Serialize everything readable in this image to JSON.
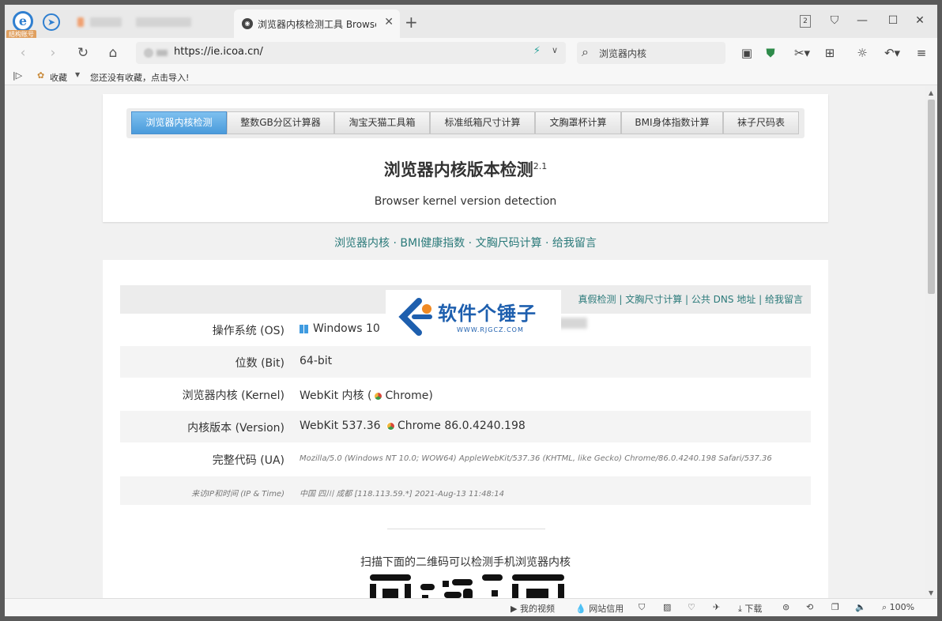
{
  "tab": {
    "active_title": "浏览器内核检测工具 Browser I",
    "close_glyph": "✕",
    "new_tab_glyph": "+",
    "tab_count": "2"
  },
  "logo": {
    "letter": "e",
    "badge": "结构账号"
  },
  "window_controls": {
    "skin": "⛉",
    "minimize": "—",
    "maximize": "☐",
    "close": "✕"
  },
  "toolbar": {
    "back": "‹",
    "forward": "›",
    "reload": "↻",
    "home": "⌂",
    "url": "https://ie.icoa.cn/",
    "bolt": "⚡",
    "url_dropdown": "∨",
    "search_text": "浏览器内核"
  },
  "bookmarks": {
    "toggle": "|▷",
    "label": "收藏",
    "empty_text": "您还没有收藏，点击导入!"
  },
  "page": {
    "nav_tabs": [
      "浏览器内核检测",
      "整数GB分区计算器",
      "淘宝天猫工具箱",
      "标准纸箱尺寸计算",
      "文胸罩杯计算",
      "BMI身体指数计算",
      "袜子尺码表"
    ],
    "title": "浏览器内核版本检测",
    "version": "2.1",
    "subtitle": "Browser kernel version detection",
    "links": "浏览器内核 · BMI健康指数 · 文胸尺码计算 · 给我留言",
    "card_links": "真假检测 | 文胸尺寸计算 | 公共 DNS 地址 | 给我留言",
    "rows": [
      {
        "label": "操作系统 (OS)",
        "value": "Windows 10"
      },
      {
        "label": "位数 (Bit)",
        "value": "64-bit"
      },
      {
        "label": "浏览器内核 (Kernel)",
        "value_pre": "WebKit 内核 (",
        "value_post": "Chrome)"
      },
      {
        "label": "内核版本 (Version)",
        "value_pre": "WebKit 537.36 ",
        "value_post": "Chrome 86.0.4240.198"
      },
      {
        "label": "完整代码 (UA)",
        "value": "Mozilla/5.0 (Windows NT 10.0; WOW64) AppleWebKit/537.36 (KHTML, like Gecko) Chrome/86.0.4240.198 Safari/537.36"
      },
      {
        "label": "来访IP和时间 (IP & Time)",
        "value": "中国 四川 成都 [118.113.59.*]    2021-Aug-13 11:48:14"
      }
    ],
    "qr_text": "扫描下面的二维码可以检测手机浏览器内核"
  },
  "watermark": {
    "title": "软件个锤子",
    "url": "WWW.RJGCZ.COM"
  },
  "statusbar": {
    "video": "我的视频",
    "credit": "网站信用",
    "download": "下载",
    "zoom": "100%"
  },
  "colors": {
    "accent": "#4a9bdb",
    "link": "#2b7a7a",
    "brand_blue": "#1e5fae"
  }
}
